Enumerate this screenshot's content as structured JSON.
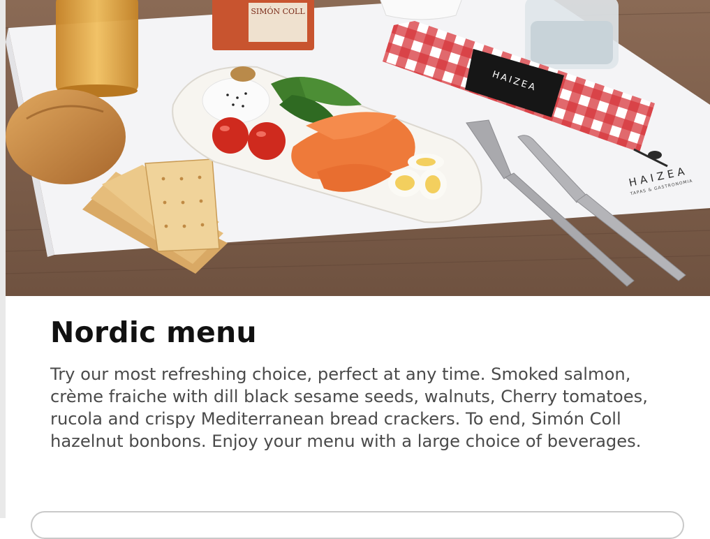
{
  "product": {
    "title": "Nordic menu",
    "description": "Try our most refreshing choice, perfect at any time. Smoked salmon, crème fraiche with dill black sesame seeds, walnuts, Cherry tomatoes, rucola and crispy Mediterranean bread crackers. To end, Simón Coll hazelnut bonbons. Enjoy your menu with a large choice of beverages."
  },
  "image": {
    "brand_logo": "HAIZEA",
    "brand_tagline": "TAPAS & GASTRONOMIA",
    "chocolate_brand": "SIMÓN COLL"
  },
  "colors": {
    "title": "#111111",
    "body_text": "#4a4a4a",
    "card_border": "#c9c9c9",
    "placemat": "#f4f4f6",
    "napkin_red": "#d6363c"
  }
}
